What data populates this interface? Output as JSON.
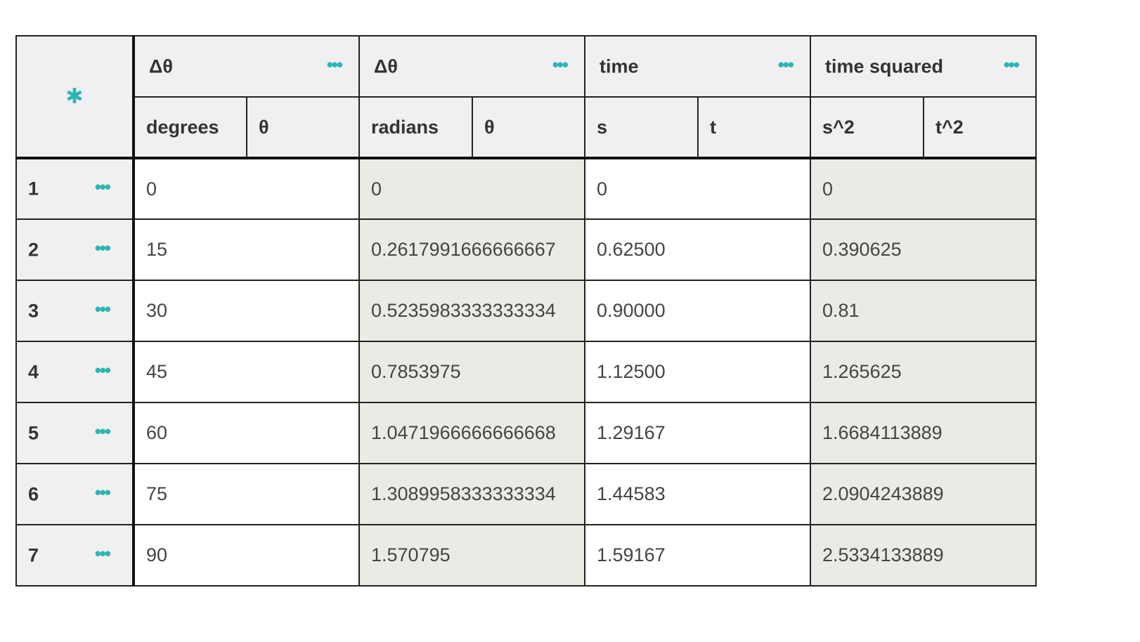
{
  "columns": [
    {
      "title": "Δθ",
      "units": "degrees",
      "symbol": "θ"
    },
    {
      "title": "Δθ",
      "units": "radians",
      "symbol": "θ"
    },
    {
      "title": "time",
      "units": "s",
      "symbol": "t"
    },
    {
      "title": "time squared",
      "units": "s^2",
      "symbol": "t^2"
    }
  ],
  "rows": [
    {
      "num": "1",
      "cells": [
        "0",
        "0",
        "0",
        "0"
      ]
    },
    {
      "num": "2",
      "cells": [
        "15",
        "0.2617991666666667",
        "0.62500",
        "0.390625"
      ]
    },
    {
      "num": "3",
      "cells": [
        "30",
        "0.5235983333333334",
        "0.90000",
        "0.81"
      ]
    },
    {
      "num": "4",
      "cells": [
        "45",
        "0.7853975",
        "1.12500",
        "1.265625"
      ]
    },
    {
      "num": "5",
      "cells": [
        "60",
        "1.0471966666666668",
        "1.29167",
        "1.6684113889"
      ]
    },
    {
      "num": "6",
      "cells": [
        "75",
        "1.3089958333333334",
        "1.44583",
        "2.0904243889"
      ]
    },
    {
      "num": "7",
      "cells": [
        "90",
        "1.570795",
        "1.59167",
        "2.5334133889"
      ]
    }
  ],
  "icons": {
    "settings": "gear-icon",
    "menu": "more-dots-icon"
  },
  "colors": {
    "accent": "#2bb5b5",
    "header_bg": "#f0f0f0",
    "shaded_cell": "#ebebe5"
  }
}
